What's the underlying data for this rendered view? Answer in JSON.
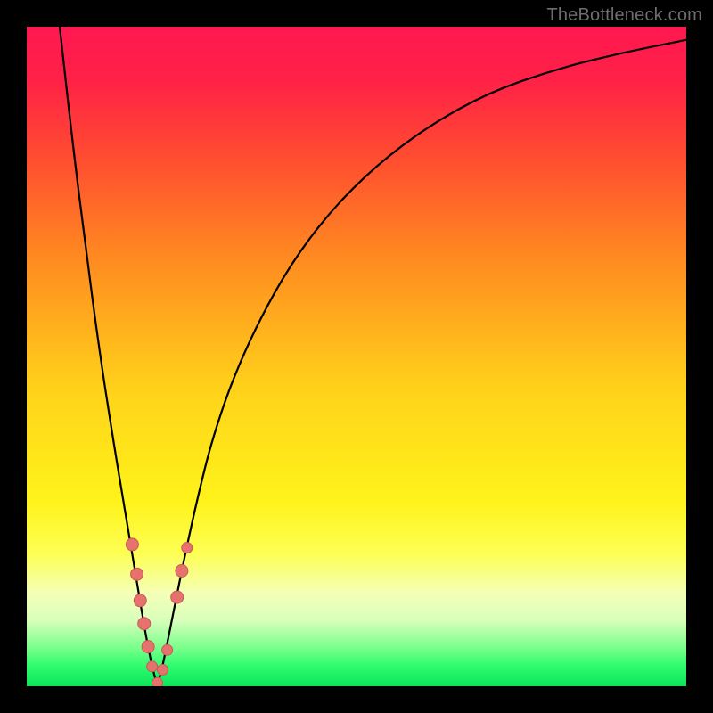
{
  "attribution": "TheBottleneck.com",
  "colors": {
    "black": "#000000",
    "curve": "#000000",
    "marker_fill": "#e6726e",
    "marker_stroke": "#c85a57",
    "gradient_stops": [
      {
        "offset": 0.0,
        "color": "#ff1850"
      },
      {
        "offset": 0.08,
        "color": "#ff2147"
      },
      {
        "offset": 0.2,
        "color": "#ff4d30"
      },
      {
        "offset": 0.35,
        "color": "#ff8a20"
      },
      {
        "offset": 0.55,
        "color": "#ffd21a"
      },
      {
        "offset": 0.72,
        "color": "#fff31a"
      },
      {
        "offset": 0.8,
        "color": "#fdff55"
      },
      {
        "offset": 0.86,
        "color": "#f4ffb8"
      },
      {
        "offset": 0.9,
        "color": "#d8ffba"
      },
      {
        "offset": 0.94,
        "color": "#7dff8d"
      },
      {
        "offset": 0.97,
        "color": "#2dfc6d"
      },
      {
        "offset": 1.0,
        "color": "#0ce45c"
      }
    ]
  },
  "chart_data": {
    "type": "line",
    "title": "",
    "xlabel": "",
    "ylabel": "",
    "xlim": [
      0,
      100
    ],
    "ylim": [
      0,
      100
    ],
    "grid": false,
    "legend": false,
    "series": [
      {
        "name": "bottleneck-curve",
        "x": [
          5,
          7,
          9,
          11,
          13,
          15,
          17,
          18,
          19,
          19.8,
          20.6,
          22,
          24,
          26,
          28,
          31,
          35,
          40,
          46,
          53,
          61,
          70,
          80,
          90,
          100
        ],
        "y": [
          100,
          82,
          66,
          51,
          38,
          26,
          14,
          8,
          3,
          0,
          3,
          10,
          20,
          29,
          37,
          46,
          55,
          64,
          72,
          79,
          85,
          90,
          93.5,
          96,
          98
        ]
      }
    ],
    "markers": [
      {
        "x": 16.0,
        "y": 21.5,
        "r": 7
      },
      {
        "x": 16.7,
        "y": 17.0,
        "r": 7
      },
      {
        "x": 17.2,
        "y": 13.0,
        "r": 7
      },
      {
        "x": 17.8,
        "y": 9.5,
        "r": 7
      },
      {
        "x": 18.4,
        "y": 6.0,
        "r": 7
      },
      {
        "x": 19.0,
        "y": 3.0,
        "r": 6
      },
      {
        "x": 19.8,
        "y": 0.5,
        "r": 6
      },
      {
        "x": 20.6,
        "y": 2.5,
        "r": 6
      },
      {
        "x": 21.3,
        "y": 5.5,
        "r": 6
      },
      {
        "x": 22.8,
        "y": 13.5,
        "r": 7
      },
      {
        "x": 23.5,
        "y": 17.5,
        "r": 7
      },
      {
        "x": 24.3,
        "y": 21.0,
        "r": 6
      }
    ]
  }
}
